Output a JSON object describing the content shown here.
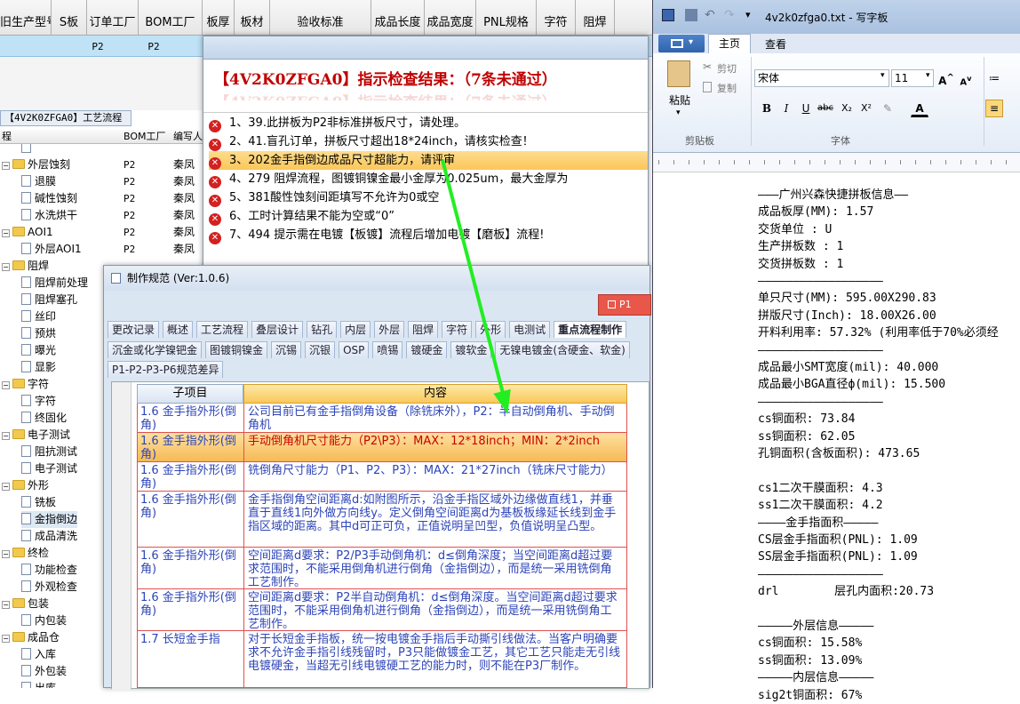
{
  "bg_table": {
    "headers": [
      "旧生产型号",
      "S板",
      "订单工厂",
      "BOM工厂",
      "板厚",
      "板材",
      "验收标准",
      "成品长度",
      "成品宽度",
      "PNL规格",
      "字符",
      "阻焊"
    ],
    "row_values": [
      "P2",
      "P2"
    ]
  },
  "tree": {
    "title": "【4V2K0ZFGA0】工艺流程",
    "headers": [
      "程",
      "BOM工厂",
      "编写人"
    ],
    "rows": [
      {
        "name": "",
        "factory": "",
        "author": "",
        "kind": "doc",
        "level": 2
      },
      {
        "name": "外层蚀刻",
        "factory": "P2",
        "author": "秦凤",
        "kind": "folder",
        "level": 1
      },
      {
        "name": "退膜",
        "factory": "P2",
        "author": "秦凤",
        "kind": "doc",
        "level": 2
      },
      {
        "name": "碱性蚀刻",
        "factory": "P2",
        "author": "秦凤",
        "kind": "doc",
        "level": 2
      },
      {
        "name": "水洗烘干",
        "factory": "P2",
        "author": "秦凤",
        "kind": "doc",
        "level": 2
      },
      {
        "name": "AOI1",
        "factory": "P2",
        "author": "秦凤",
        "kind": "folder",
        "level": 1
      },
      {
        "name": "外层AOI1",
        "factory": "P2",
        "author": "秦凤",
        "kind": "doc",
        "level": 2
      },
      {
        "name": "阻焊",
        "factory": "",
        "author": "",
        "kind": "folder",
        "level": 1
      },
      {
        "name": "阻焊前处理",
        "factory": "",
        "author": "",
        "kind": "doc",
        "level": 2
      },
      {
        "name": "阻焊塞孔",
        "factory": "",
        "author": "",
        "kind": "doc",
        "level": 2
      },
      {
        "name": "丝印",
        "factory": "",
        "author": "",
        "kind": "doc",
        "level": 2
      },
      {
        "name": "预烘",
        "factory": "",
        "author": "",
        "kind": "doc",
        "level": 2
      },
      {
        "name": "曝光",
        "factory": "",
        "author": "",
        "kind": "doc",
        "level": 2
      },
      {
        "name": "显影",
        "factory": "",
        "author": "",
        "kind": "doc",
        "level": 2
      },
      {
        "name": "字符",
        "factory": "",
        "author": "",
        "kind": "folder",
        "level": 1
      },
      {
        "name": "字符",
        "factory": "",
        "author": "",
        "kind": "doc",
        "level": 2
      },
      {
        "name": "终固化",
        "factory": "",
        "author": "",
        "kind": "doc",
        "level": 2
      },
      {
        "name": "电子测试",
        "factory": "",
        "author": "",
        "kind": "folder",
        "level": 1
      },
      {
        "name": "阻抗测试",
        "factory": "",
        "author": "",
        "kind": "doc",
        "level": 2
      },
      {
        "name": "电子测试",
        "factory": "",
        "author": "",
        "kind": "doc",
        "level": 2
      },
      {
        "name": "外形",
        "factory": "",
        "author": "",
        "kind": "folder",
        "level": 1
      },
      {
        "name": "铣板",
        "factory": "",
        "author": "",
        "kind": "doc",
        "level": 2
      },
      {
        "name": "金指倒边",
        "factory": "",
        "author": "",
        "kind": "doc",
        "level": 2
      },
      {
        "name": "成品清洗",
        "factory": "",
        "author": "",
        "kind": "doc",
        "level": 2
      },
      {
        "name": "终检",
        "factory": "",
        "author": "",
        "kind": "folder",
        "level": 1
      },
      {
        "name": "功能检查",
        "factory": "",
        "author": "",
        "kind": "doc",
        "level": 2
      },
      {
        "name": "外观检查",
        "factory": "",
        "author": "",
        "kind": "doc",
        "level": 2
      },
      {
        "name": "包装",
        "factory": "",
        "author": "",
        "kind": "folder",
        "level": 1
      },
      {
        "name": "内包装",
        "factory": "",
        "author": "",
        "kind": "doc",
        "level": 2
      },
      {
        "name": "成品仓",
        "factory": "",
        "author": "",
        "kind": "folder",
        "level": 1
      },
      {
        "name": "入库",
        "factory": "",
        "author": "",
        "kind": "doc",
        "level": 2
      },
      {
        "name": "外包装",
        "factory": "",
        "author": "",
        "kind": "doc",
        "level": 2
      },
      {
        "name": "出库",
        "factory": "",
        "author": "",
        "kind": "doc",
        "level": 2
      }
    ]
  },
  "check": {
    "heading": "【4V2K0ZFGA0】指示检查结果：（7条未通过）",
    "items": [
      "1、39.此拼板为P2非标准拼板尺寸，请处理。",
      "2、41.盲孔订单，拼板尺寸超出18*24inch，请核实检查！",
      "3、202金手指倒边成品尺寸超能力，请评审",
      "4、279 阻焊流程，图镀铜镍金最小金厚为0.025um，最大金厚为",
      "5、381酸性蚀刻间距填写不允许为0或空",
      "6、工时计算结果不能为空或“0”",
      "7、494 提示需在电镀【板镀】流程后增加电镀【磨板】流程!"
    ],
    "selected_index": 2
  },
  "spec": {
    "title": "制作规范 (Ver:1.0.6)",
    "p1_label": "P1",
    "tabs_row1": [
      "更改记录",
      "概述",
      "工艺流程",
      "叠层设计",
      "钻孔",
      "内层",
      "外层",
      "阻焊",
      "字符",
      "外形",
      "电测试",
      "重点流程制作"
    ],
    "tabs_row2": [
      "沉金或化学镍钯金",
      "图镀铜镍金",
      "沉锡",
      "沉银",
      "OSP",
      "喷锡",
      "镀硬金",
      "镀软金",
      "无镍电镀金(含硬金、软金)"
    ],
    "tabs_row3": [
      "P1-P2-P3-P6规范差异"
    ],
    "active_tab": "重点流程制作",
    "col_sub": "子项目",
    "col_content": "内容",
    "rows": [
      {
        "sub": "1.6 金手指外形(倒角)",
        "content": "公司目前已有金手指倒角设备（除铣床外），P2：半自动倒角机、手动倒角机"
      },
      {
        "sub": "1.6 金手指外形(倒角)",
        "content": "手动倒角机尺寸能力（P2\\P3）：MAX：12*18inch；MIN：2*2inch"
      },
      {
        "sub": "1.6 金手指外形(倒角)",
        "content": "铣倒角尺寸能力（P1、P2、P3）：MAX：21*27inch（铣床尺寸能力）"
      },
      {
        "sub": "1.6 金手指外形(倒角)",
        "content": "金手指倒角空间距离d:如附图所示，沿金手指区域外边缘做直线1，并垂直于直线1向外做方向线y。定义倒角空间距离d为基板板缘延长线到金手指区域的距离。其中d可正可负，正值说明呈凹型，负值说明呈凸型。"
      },
      {
        "sub": "1.6 金手指外形(倒角)",
        "content": "空间距离d要求：P2/P3手动倒角机：d≤倒角深度；当空间距离d超过要求范围时，不能采用倒角机进行倒角（金指倒边），而是统一采用铣倒角工艺制作。"
      },
      {
        "sub": "1.6 金手指外形(倒角)",
        "content": "空间距离d要求：P2半自动倒角机：d≤倒角深度。当空间距离d超过要求范围时，不能采用倒角机进行倒角（金指倒边），而是统一采用铣倒角工艺制作。"
      },
      {
        "sub": "1.7 长短金手指",
        "content": "对于长短金手指板，统一按电镀金手指后手动撕引线做法。当客户明确要求不允许金手指引线残留时，P3只能做镀金工艺，其它工艺只能走无引线电镀硬金，当超无引线电镀硬工艺的能力时，则不能在P3厂制作。"
      }
    ],
    "highlight_row": 1
  },
  "wordpad": {
    "title": "4v2k0zfga0.txt - 写字板",
    "tab_home": "主页",
    "tab_view": "查看",
    "paste": "粘贴",
    "cut": "剪切",
    "copy": "复制",
    "clipboard": "剪贴板",
    "font_name": "宋体",
    "font_size": "11",
    "font_group": "字体",
    "lines": [
      "———广州兴森快捷拼板信息——",
      "成品板厚(MM): 1.57",
      "交货单位 : U",
      "生产拼板数 : 1",
      "交货拼板数 : 1",
      "——————————————————",
      "单只尺寸(MM): 595.00X290.83",
      "拼版尺寸(Inch): 18.00X26.00",
      "开料利用率: 57.32% (利用率低于70%必须经",
      "——————————————————",
      "成品最小SMT宽度(mil): 40.000",
      "成品最小BGA直径ф(mil): 15.500",
      "——————————————————",
      "cs铜面积: 73.84",
      "ss铜面积: 62.05",
      "孔铜面积(含板面积): 473.65",
      "",
      "cs1二次干膜面积: 4.3",
      "ss1二次干膜面积: 4.2",
      "————金手指面积—————",
      "CS层金手指面积(PNL): 1.09",
      "SS层金手指面积(PNL): 1.09",
      "——————————————————",
      "drl        层孔内面积:20.73",
      "",
      "—————外层信息—————",
      "cs铜面积: 15.58%",
      "ss铜面积: 13.09%",
      "—————内层信息—————",
      "sig2t铜面积: 67%"
    ]
  },
  "colors": {
    "error": "#d42020",
    "highlight": "#f9c85a",
    "heading_red": "#c00000",
    "arrow": "#22ee22",
    "link_blue": "#2d44b8"
  }
}
